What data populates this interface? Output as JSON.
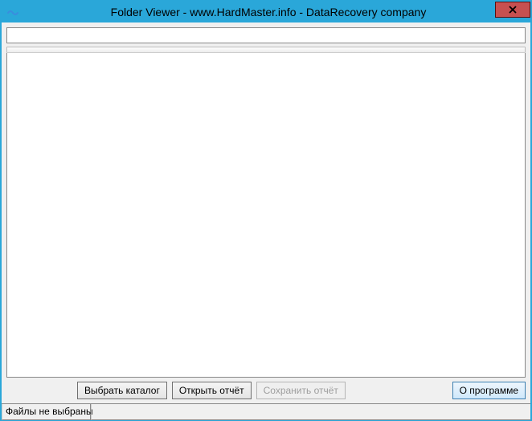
{
  "window": {
    "title": "Folder Viewer - www.HardMaster.info - DataRecovery company"
  },
  "path_input": {
    "value": "",
    "placeholder": ""
  },
  "buttons": {
    "select_folder": "Выбрать каталог",
    "open_report": "Открыть отчёт",
    "save_report": "Сохранить отчёт",
    "about": "О программе"
  },
  "status": {
    "files_status": "Файлы не выбраны"
  }
}
